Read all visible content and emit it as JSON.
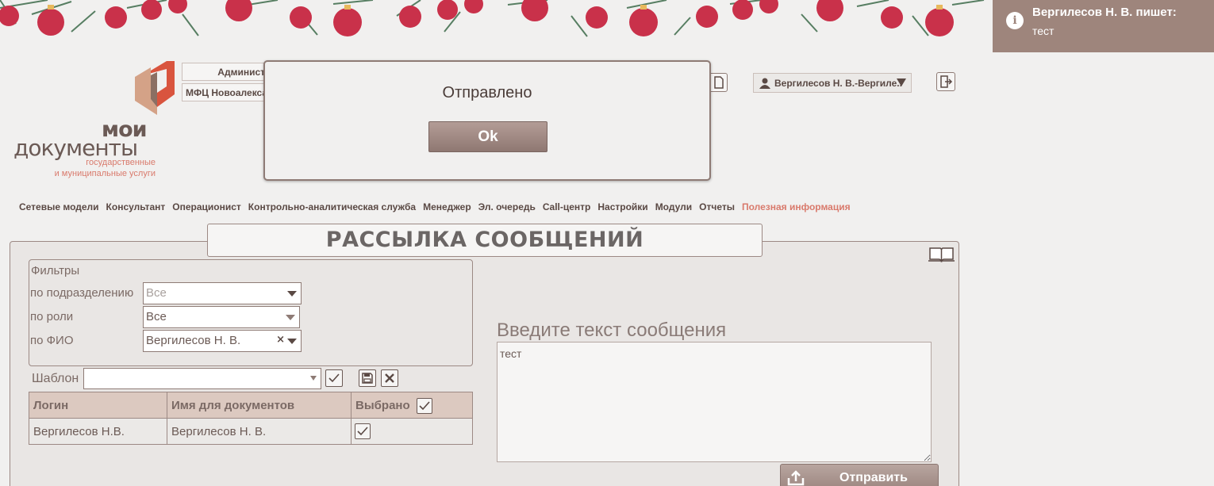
{
  "notification": {
    "title": "Вергилесов Н. В. пишет:",
    "text": "тест"
  },
  "logo": {
    "line1": "мои",
    "line2": "документы",
    "sub1": "государственные",
    "sub2": "и муниципальные услуги"
  },
  "header": {
    "role": "Админист",
    "org": "МФЦ Новоалекса",
    "user": "Вергилесов Н. В.-Вергиле.."
  },
  "nav": [
    "Сетевые модели",
    "Консультант",
    "Операционист",
    "Контрольно-аналитическая служба",
    "Менеджер",
    "Эл. очередь",
    "Call-центр",
    "Настройки",
    "Модули",
    "Отчеты",
    "Полезная информация"
  ],
  "page_title": "РАССЫЛКА СООБЩЕНИЙ",
  "filters": {
    "title": "Фильтры",
    "by_unit_label": "по подразделению",
    "by_unit_value": "Все",
    "by_role_label": "по роли",
    "by_role_value": "Все",
    "by_fio_label": "по ФИО",
    "by_fio_value": "Вергилесов Н. В.",
    "clear_glyph": "×"
  },
  "template": {
    "label": "Шаблон",
    "value": ""
  },
  "table": {
    "headers": [
      "Логин",
      "Имя для документов",
      "Выбрано"
    ],
    "rows": [
      [
        "Вергилесов Н.В.",
        "Вергилесов Н. В."
      ]
    ]
  },
  "message": {
    "label": "Введите текст сообщения",
    "value": "тест"
  },
  "send_label": "Отправить",
  "modal": {
    "message": "Отправлено",
    "ok": "Ok"
  },
  "colors": {
    "accent": "#d97a6c",
    "brown": "#9e857c",
    "panel": "#e9e6e4"
  },
  "icons": [
    "info-icon",
    "user-icon",
    "logout-icon",
    "document-icon",
    "book-icon",
    "save-icon",
    "close-icon",
    "check-icon",
    "upload-icon",
    "ornament-icon"
  ]
}
